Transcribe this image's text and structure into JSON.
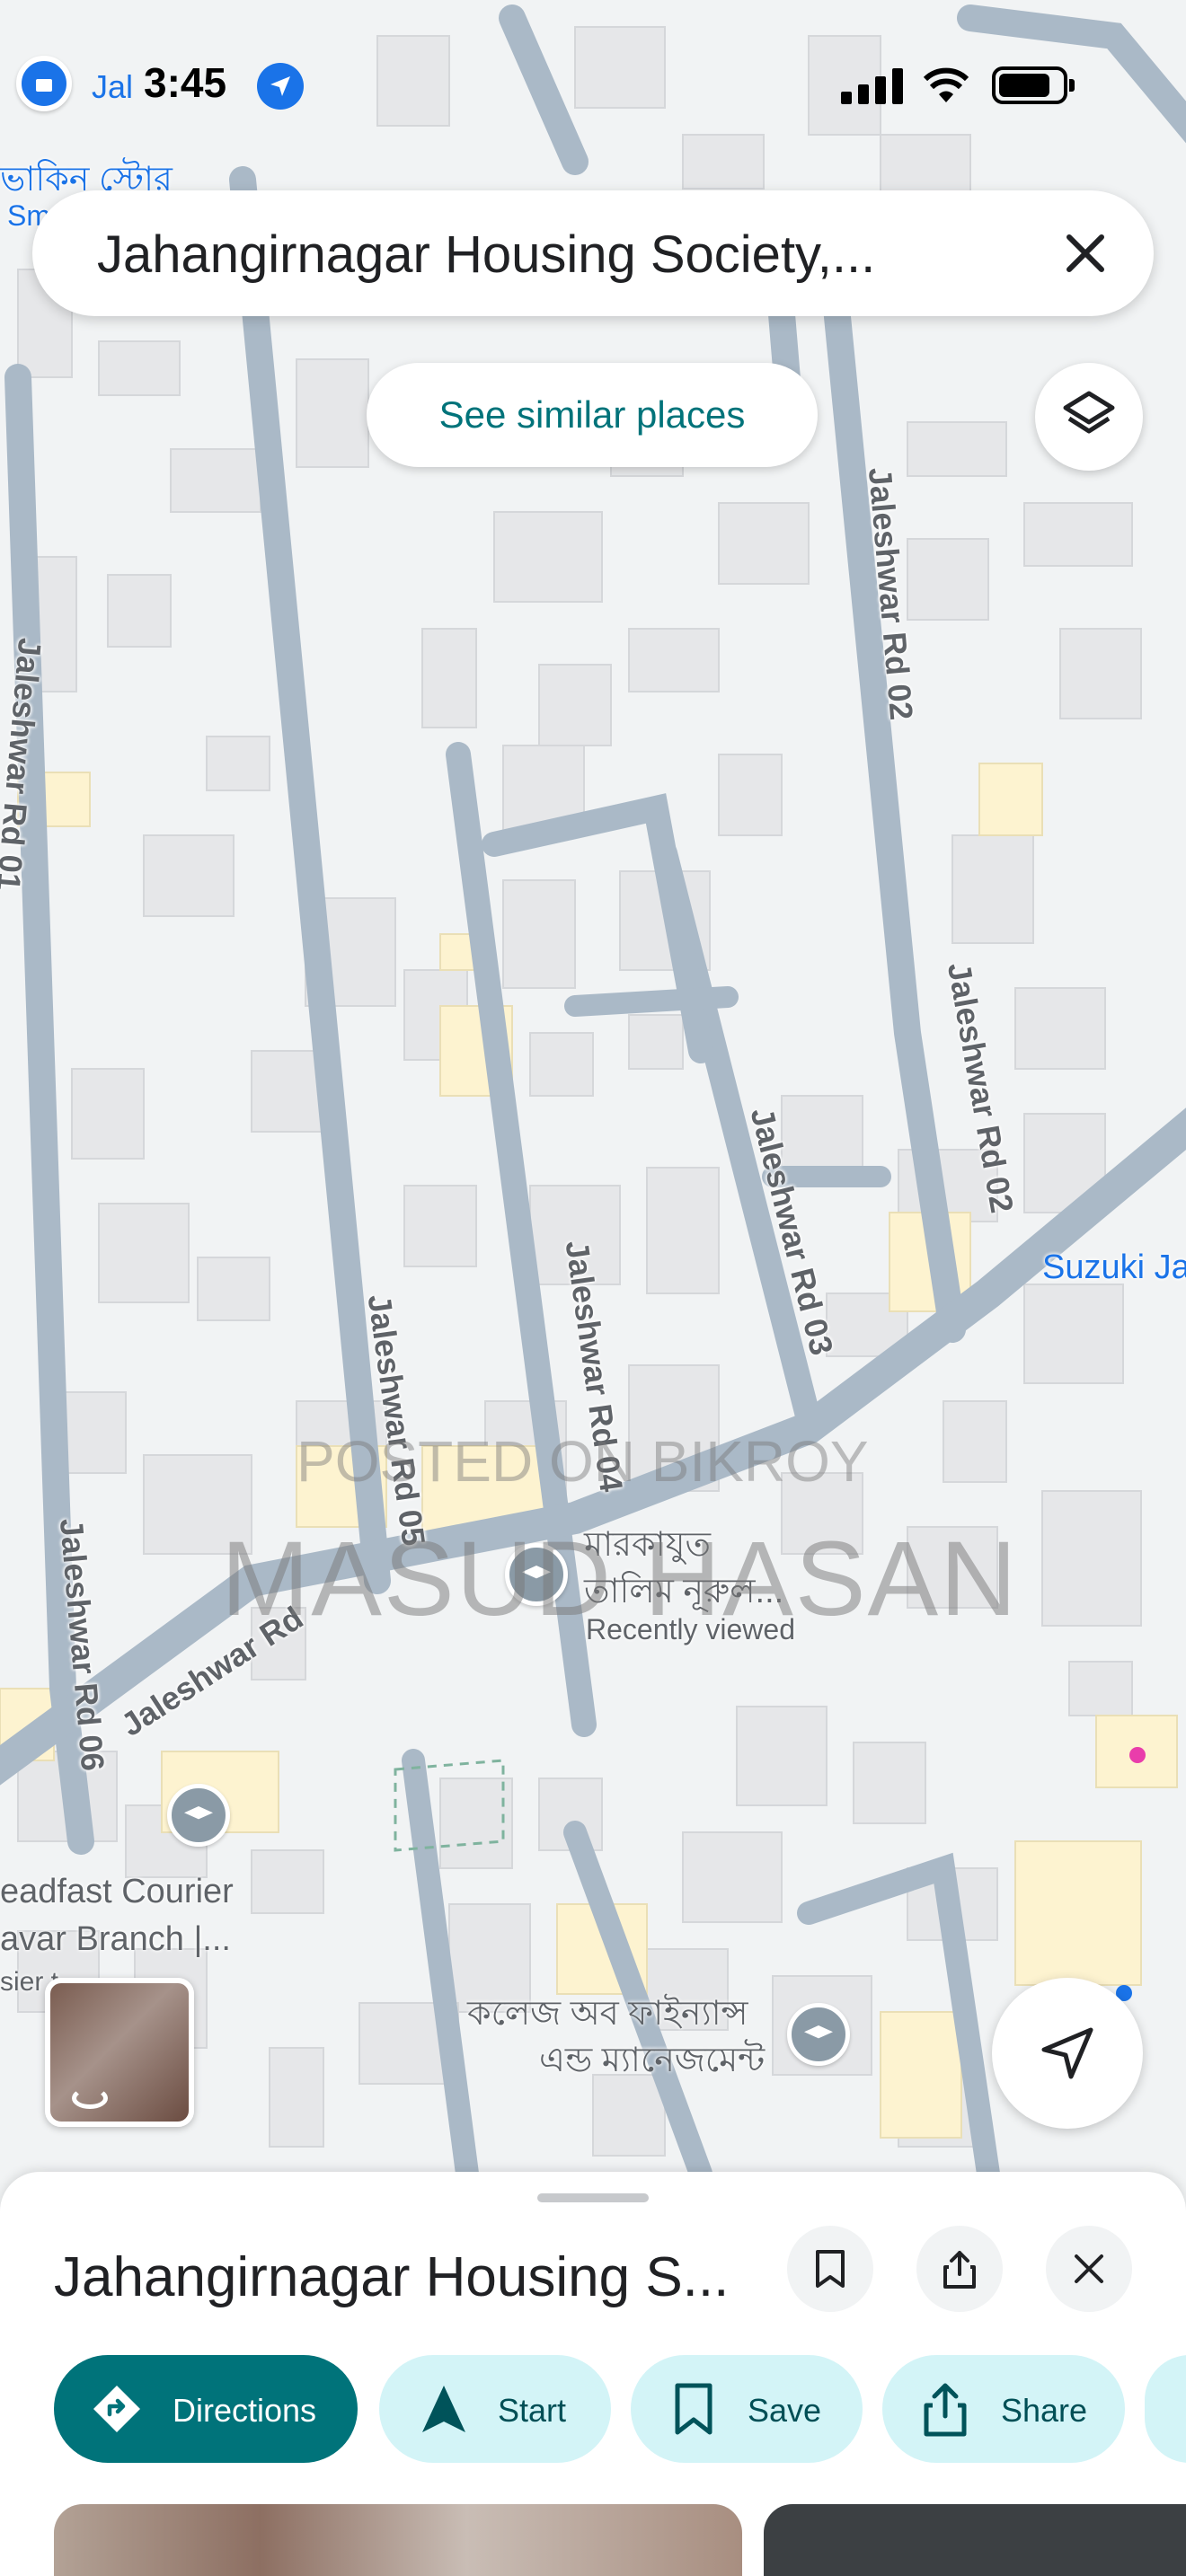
{
  "status_bar": {
    "time": "3:45",
    "back_app": "Jal"
  },
  "search": {
    "query": "Jahangirnagar Housing Society,..."
  },
  "map": {
    "see_similar_label": "See similar places",
    "labels": {
      "store_bn": "ভাকিন স্টোর",
      "store_bn_sub": "Sm",
      "road_02_top": "Jaleshwar Rd 02",
      "road_02_right": "Jaleshwar Rd 02",
      "road_03": "Jaleshwar Rd 03",
      "road_04": "Jaleshwar Rd 04",
      "road_05": "Jaleshwar Rd 05",
      "road_06": "Jaleshwar Rd 06",
      "road_left": "Jaleshwar Rd 01",
      "main_road": "Jaleshwar Rd",
      "suzuki": "Suzuki Ja",
      "madrasa_line1": "মারকাযুত",
      "madrasa_line2": "তালিম নূরুল...",
      "recently_viewed": "Recently viewed",
      "courier_line1": "eadfast Courier",
      "courier_line2": "avar Branch |...",
      "courier_line3": "sier t",
      "college_line1": "কলেজ অব ফাইন্যান্স",
      "college_line2": "এন্ড ম্যানেজমেন্ট"
    },
    "watermark_small": "POSTED ON BIKROY",
    "watermark_large": "MASUD HASAN"
  },
  "sheet": {
    "title": "Jahangirnagar Housing S...",
    "chips": [
      {
        "label": "Directions",
        "icon": "directions-icon"
      },
      {
        "label": "Start",
        "icon": "navigation-arrow-icon"
      },
      {
        "label": "Save",
        "icon": "bookmark-icon"
      },
      {
        "label": "Share",
        "icon": "share-icon"
      }
    ]
  },
  "colors": {
    "accent": "#00737a",
    "chip_bg": "#d3f4f7",
    "road": "#aab9c7",
    "building": "#e8e9eb",
    "map_bg": "#f1f3f4",
    "poi_yellow": "#fdf3d0"
  }
}
